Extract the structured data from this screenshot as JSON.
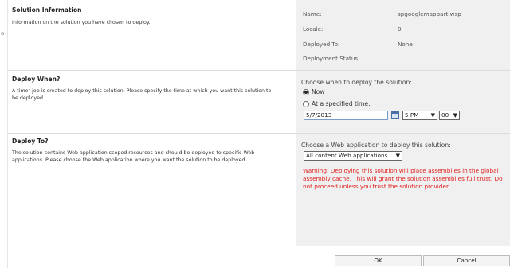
{
  "solution_info": {
    "title": "Solution Information",
    "description": "Information on the solution you have chosen to deploy.",
    "fields": [
      {
        "label": "Name:",
        "value": "spgooglemappart.wsp"
      },
      {
        "label": "Locale:",
        "value": "0"
      },
      {
        "label": "Deployed To:",
        "value": "None"
      },
      {
        "label": "Deployment Status:",
        "value": ""
      }
    ]
  },
  "deploy_when": {
    "title": "Deploy When?",
    "description": "A timer job is created to deploy this solution. Please specify the time at which you want this solution to be deployed.",
    "prompt": "Choose when to deploy the solution:",
    "options": [
      {
        "label": "Now",
        "selected": true
      },
      {
        "label": "At a specified time:",
        "selected": false
      }
    ],
    "date_value": "5/7/2013",
    "hour_value": "5 PM",
    "minute_value": "00"
  },
  "deploy_to": {
    "title": "Deploy To?",
    "description": "The solution contains Web application scoped resources and should be deployed to specific Web applications. Please choose the Web application where you want the solution to be deployed.",
    "prompt": "Choose a Web application to deploy this solution:",
    "selected_app": "All content Web applications",
    "warning": "Warning: Deploying this solution will place assemblies in the global assembly cache. This will grant the solution assemblies full trust. Do not proceed unless you trust the solution provider."
  },
  "buttons": {
    "ok": "OK",
    "cancel": "Cancel"
  },
  "colors": {
    "panel_bg": "#f0f0f0",
    "warning": "#e02020"
  }
}
